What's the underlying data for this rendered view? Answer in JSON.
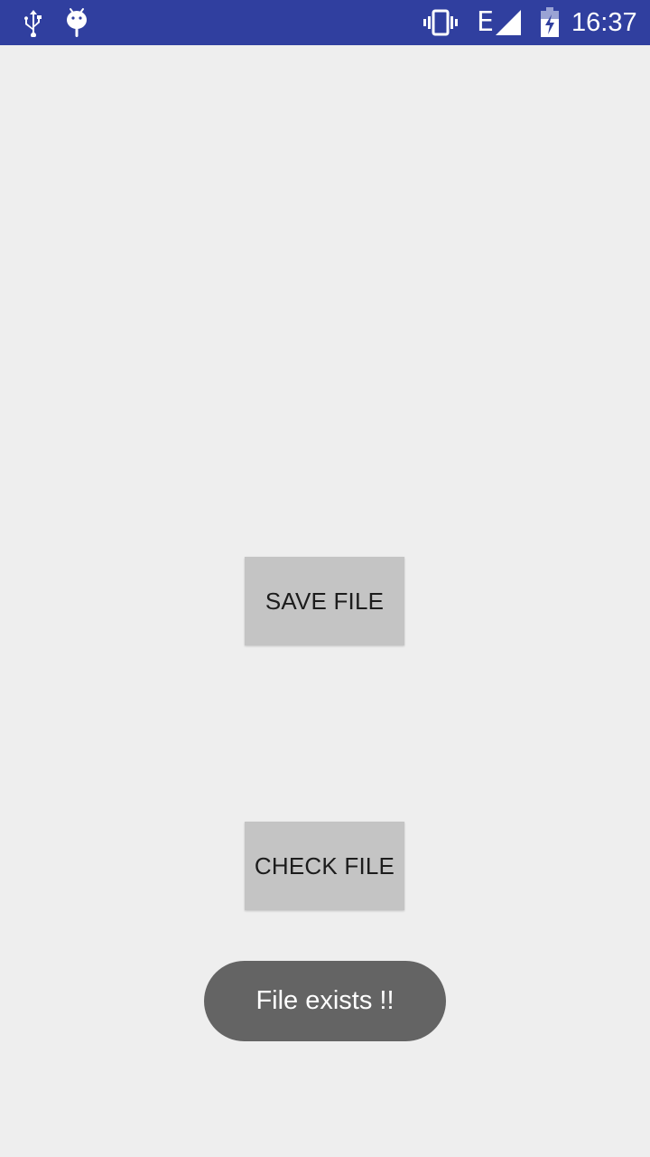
{
  "status_bar": {
    "background_color": "#303f9f",
    "left_icons": [
      "usb-icon",
      "android-debug-icon"
    ],
    "right_icons": [
      "vibrate-icon",
      "signal-icon",
      "battery-charging-icon"
    ],
    "network_type": "E",
    "time": "16:37"
  },
  "main": {
    "background_color": "#eeeeee",
    "save_button_label": "SAVE FILE",
    "check_button_label": "CHECK FILE"
  },
  "toast": {
    "message": "File exists !!",
    "background_color": "#646464"
  }
}
